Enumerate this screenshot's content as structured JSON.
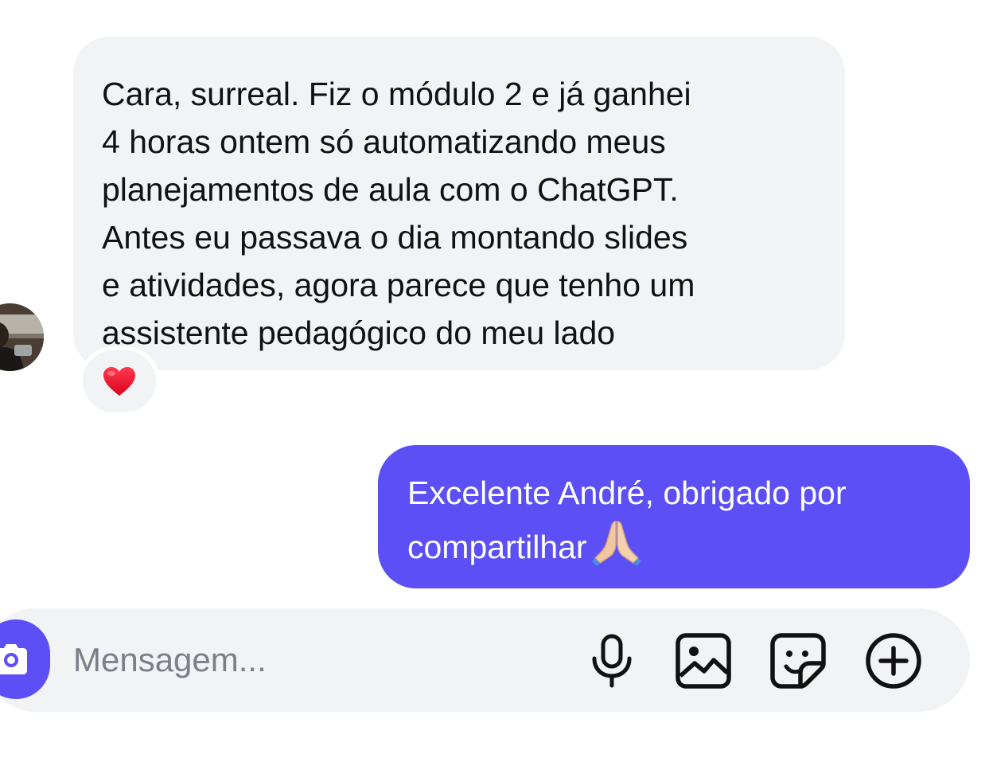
{
  "conversation": {
    "incoming": {
      "text": "Cara, surreal. Fiz o módulo 2 e já ganhei\n4 horas ontem só automatizando meus\nplanejamentos de aula com o ChatGPT.\nAntes eu passava o dia montando slides\ne atividades, agora parece que tenho um\nassistente pedagógico do meu lado",
      "reaction": "heart-icon"
    },
    "outgoing": {
      "text": "Excelente André, obrigado por\ncompartilhar",
      "emoji": "folded-hands-emoji"
    }
  },
  "composer": {
    "placeholder": "Mensagem...",
    "icons": [
      "camera-icon",
      "microphone-icon",
      "image-icon",
      "sticker-icon",
      "plus-circle-icon"
    ]
  },
  "colors": {
    "accent": "#5b4ff5",
    "incoming_bubble": "#f2f3f5",
    "heart": "#e8112d"
  }
}
